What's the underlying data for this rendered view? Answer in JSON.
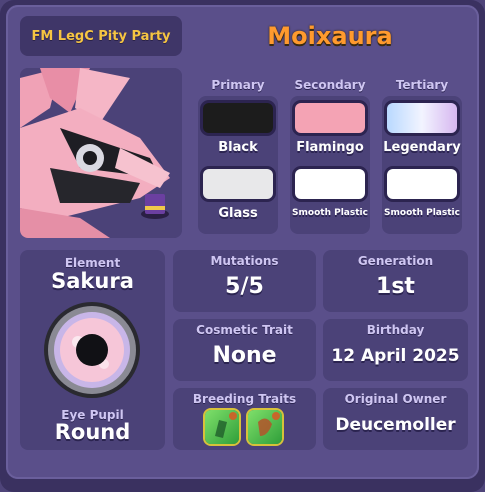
{
  "header": {
    "badge": "FM LegC Pity Party",
    "name": "Moixaura"
  },
  "colors": {
    "primary": {
      "heading": "Primary",
      "swatch": "#1c1c1c",
      "label": "Black"
    },
    "primary2": {
      "swatch": "#e8e8ea",
      "label": "Glass"
    },
    "secondary": {
      "heading": "Secondary",
      "swatch": "#f4a3b4",
      "label": "Flamingo"
    },
    "secondary2": {
      "swatch": "#ffffff",
      "label": "Smooth Plastic"
    },
    "tertiary": {
      "heading": "Tertiary",
      "swatch": "legendary-gradient",
      "label": "Legendary"
    },
    "tertiary2": {
      "swatch": "#ffffff",
      "label": "Smooth Plastic"
    }
  },
  "stats": {
    "element_label": "Element",
    "element_value": "Sakura",
    "eye_label": "Eye Pupil",
    "eye_value": "Round",
    "mutations_label": "Mutations",
    "mutations_value": "5/5",
    "generation_label": "Generation",
    "generation_value": "1st",
    "cosmetic_label": "Cosmetic Trait",
    "cosmetic_value": "None",
    "birthday_label": "Birthday",
    "birthday_value": "12 April 2025",
    "breeding_label": "Breeding Traits",
    "breeding_icons": [
      "breeding-trait-icon",
      "breeding-trait-icon"
    ],
    "owner_label": "Original Owner",
    "owner_value": "Deucemoller"
  },
  "accent": {
    "title": "#f6c542",
    "name": "#ff9a2e"
  }
}
